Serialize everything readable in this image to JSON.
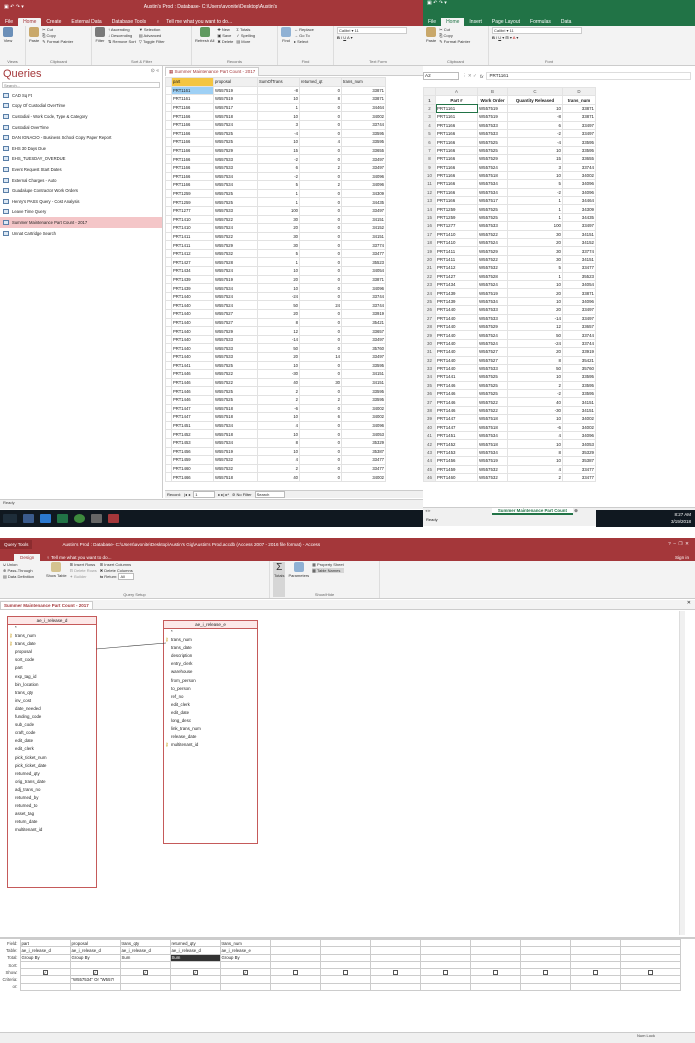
{
  "top_access": {
    "title": "Austin's Prod : Database- C:\\Users\\avonite\\Desktop\\Austin's",
    "tabs": [
      "File",
      "Home",
      "Create",
      "External Data",
      "Database Tools"
    ],
    "tell_me": "Tell me what you want to do...",
    "ribbon": {
      "view": "View",
      "paste": "Paste",
      "cut": "Cut",
      "copy": "Copy",
      "format_painter": "Format Painter",
      "filter": "Filter",
      "ascending": "Ascending",
      "descending": "Descending",
      "remove_sort": "Remove Sort",
      "selection": "Selection",
      "advanced": "Advanced",
      "toggle_filter": "Toggle Filter",
      "refresh": "Refresh All",
      "new": "New",
      "save": "Save",
      "delete": "Delete",
      "totals": "Totals",
      "spelling": "Spelling",
      "more": "More",
      "find": "Find",
      "replace": "Replace",
      "goto": "Go To",
      "select": "Select",
      "font": "Calibri",
      "size": "11",
      "groups": [
        "Views",
        "Clipboard",
        "Sort & Filter",
        "Records",
        "Find",
        "Text Form"
      ]
    },
    "nav": {
      "header": "Queries",
      "search": "Search...",
      "items": [
        "CAD Sq Ft",
        "Copy Of Custodial OverTime",
        "Custodial - Work Code, Type & Category",
        "Custodial OverTime",
        "DAN IGNACIO - Business School Copy Paper Report",
        "EHS 30 Days Due",
        "EHS_TUESDAY_OVERDUE",
        "Event Request Start Dates",
        "External Charges - Auto",
        "Guadalupe Contractor Work Orders",
        "Henry's PASS Query - Cost Analysis",
        "Leave Time Query",
        "Summer Maintenance Part Count - 2017",
        "Unnat Cartridge Search"
      ],
      "selected_index": 12
    },
    "doc_tab": "Summer Maintenance Part Count - 2017",
    "columns": [
      "part",
      "proposal",
      "SumOfTrans",
      "returned_qt",
      "trans_num"
    ],
    "rows": [
      [
        "PRT1161",
        "W557519",
        "-8",
        "0",
        "33871"
      ],
      [
        "PRT1161",
        "W557519",
        "10",
        "8",
        "33871"
      ],
      [
        "PRT1166",
        "W557517",
        "1",
        "0",
        "34464"
      ],
      [
        "PRT1166",
        "W557518",
        "10",
        "0",
        "34002"
      ],
      [
        "PRT1166",
        "W557524",
        "3",
        "0",
        "33744"
      ],
      [
        "PRT1166",
        "W557525",
        "-4",
        "0",
        "33595"
      ],
      [
        "PRT1166",
        "W557525",
        "10",
        "4",
        "33595"
      ],
      [
        "PRT1166",
        "W557529",
        "15",
        "0",
        "33655"
      ],
      [
        "PRT1166",
        "W557533",
        "-2",
        "0",
        "33497"
      ],
      [
        "PRT1166",
        "W557533",
        "6",
        "2",
        "33497"
      ],
      [
        "PRT1166",
        "W557534",
        "-2",
        "0",
        "34096"
      ],
      [
        "PRT1166",
        "W557534",
        "5",
        "2",
        "34096"
      ],
      [
        "PRT1259",
        "W557525",
        "1",
        "0",
        "34309"
      ],
      [
        "PRT1259",
        "W557525",
        "1",
        "0",
        "34435"
      ],
      [
        "PRT1277",
        "W557533",
        "100",
        "0",
        "33497"
      ],
      [
        "PRT1410",
        "W557522",
        "30",
        "0",
        "34151"
      ],
      [
        "PRT1410",
        "W557524",
        "20",
        "0",
        "34152"
      ],
      [
        "PRT1411",
        "W557522",
        "30",
        "0",
        "34151"
      ],
      [
        "PRT1411",
        "W557529",
        "30",
        "0",
        "33774"
      ],
      [
        "PRT1412",
        "W557532",
        "5",
        "0",
        "33477"
      ],
      [
        "PRT1427",
        "W557528",
        "1",
        "0",
        "35523"
      ],
      [
        "PRT1434",
        "W557524",
        "10",
        "0",
        "34054"
      ],
      [
        "PRT1439",
        "W557519",
        "20",
        "0",
        "33871"
      ],
      [
        "PRT1439",
        "W557534",
        "10",
        "0",
        "34096"
      ],
      [
        "PRT1440",
        "W557524",
        "-24",
        "0",
        "33744"
      ],
      [
        "PRT1440",
        "W557524",
        "50",
        "24",
        "33744"
      ],
      [
        "PRT1440",
        "W557527",
        "20",
        "0",
        "33919"
      ],
      [
        "PRT1440",
        "W557527",
        "8",
        "0",
        "35421"
      ],
      [
        "PRT1440",
        "W557529",
        "12",
        "0",
        "33657"
      ],
      [
        "PRT1440",
        "W557533",
        "-14",
        "0",
        "33497"
      ],
      [
        "PRT1440",
        "W557533",
        "50",
        "0",
        "35760"
      ],
      [
        "PRT1440",
        "W557533",
        "20",
        "14",
        "33497"
      ],
      [
        "PRT1441",
        "W557525",
        "10",
        "0",
        "33595"
      ],
      [
        "PRT1446",
        "W557522",
        "-30",
        "0",
        "34151"
      ],
      [
        "PRT1446",
        "W557522",
        "40",
        "30",
        "34151"
      ],
      [
        "PRT1446",
        "W557525",
        "2",
        "0",
        "33595"
      ],
      [
        "PRT1446",
        "W557525",
        "2",
        "2",
        "33595"
      ],
      [
        "PRT1447",
        "W557518",
        "-6",
        "0",
        "34002"
      ],
      [
        "PRT1447",
        "W557518",
        "10",
        "6",
        "34002"
      ],
      [
        "PRT1451",
        "W557534",
        "4",
        "0",
        "34096"
      ],
      [
        "PRT1452",
        "W557518",
        "10",
        "0",
        "34053"
      ],
      [
        "PRT1453",
        "W557534",
        "8",
        "0",
        "35329"
      ],
      [
        "PRT1456",
        "W557519",
        "10",
        "0",
        "35387"
      ],
      [
        "PRT1459",
        "W557532",
        "4",
        "0",
        "33477"
      ],
      [
        "PRT1460",
        "W557532",
        "2",
        "0",
        "33477"
      ],
      [
        "PRT1466",
        "W557518",
        "40",
        "0",
        "34002"
      ]
    ],
    "record_nav": {
      "label": "Record:",
      "current": "1",
      "no_filter": "No Filter",
      "search": "Search"
    },
    "status": "Ready"
  },
  "excel": {
    "tabs": [
      "File",
      "Home",
      "Insert",
      "Page Layout",
      "Formulas",
      "Data"
    ],
    "ribbon": {
      "paste": "Paste",
      "cut": "Cut",
      "copy": "Copy",
      "format_painter": "Format Painter",
      "font": "Calibri",
      "size": "11",
      "groups": [
        "Clipboard",
        "Font"
      ]
    },
    "namebox": "A2",
    "fx": "fx",
    "formula": "PRT1161",
    "col_letters": [
      "A",
      "B",
      "C",
      "D"
    ],
    "headers": [
      "Part #",
      "Work Order",
      "Quantity Released",
      "trans_num"
    ],
    "rows": [
      [
        "PRT1161",
        "W557519",
        "10",
        "33871"
      ],
      [
        "PRT1161",
        "W557519",
        "-8",
        "33871"
      ],
      [
        "PRT1166",
        "W557533",
        "6",
        "33497"
      ],
      [
        "PRT1166",
        "W557533",
        "-2",
        "33497"
      ],
      [
        "PRT1166",
        "W557525",
        "-4",
        "33595"
      ],
      [
        "PRT1166",
        "W557525",
        "10",
        "33595"
      ],
      [
        "PRT1166",
        "W557529",
        "15",
        "33655"
      ],
      [
        "PRT1166",
        "W557524",
        "3",
        "33744"
      ],
      [
        "PRT1166",
        "W557518",
        "10",
        "34002"
      ],
      [
        "PRT1166",
        "W557534",
        "5",
        "34096"
      ],
      [
        "PRT1166",
        "W557534",
        "-2",
        "34096"
      ],
      [
        "PRT1166",
        "W557517",
        "1",
        "34464"
      ],
      [
        "PRT1259",
        "W557525",
        "1",
        "34309"
      ],
      [
        "PRT1259",
        "W557525",
        "1",
        "34435"
      ],
      [
        "PRT1277",
        "W557533",
        "100",
        "33497"
      ],
      [
        "PRT1410",
        "W557522",
        "30",
        "34151"
      ],
      [
        "PRT1410",
        "W557524",
        "20",
        "34152"
      ],
      [
        "PRT1411",
        "W557529",
        "30",
        "33774"
      ],
      [
        "PRT1411",
        "W557522",
        "30",
        "34151"
      ],
      [
        "PRT1412",
        "W557532",
        "5",
        "33477"
      ],
      [
        "PRT1427",
        "W557528",
        "1",
        "35523"
      ],
      [
        "PRT1434",
        "W557524",
        "10",
        "34054"
      ],
      [
        "PRT1439",
        "W557519",
        "20",
        "33871"
      ],
      [
        "PRT1439",
        "W557534",
        "10",
        "34096"
      ],
      [
        "PRT1440",
        "W557533",
        "20",
        "33497"
      ],
      [
        "PRT1440",
        "W557533",
        "-14",
        "33497"
      ],
      [
        "PRT1440",
        "W557529",
        "12",
        "33657"
      ],
      [
        "PRT1440",
        "W557524",
        "50",
        "33744"
      ],
      [
        "PRT1440",
        "W557524",
        "-24",
        "33744"
      ],
      [
        "PRT1440",
        "W557527",
        "20",
        "33919"
      ],
      [
        "PRT1440",
        "W557527",
        "8",
        "35421"
      ],
      [
        "PRT1440",
        "W557533",
        "50",
        "35760"
      ],
      [
        "PRT1441",
        "W557525",
        "10",
        "33595"
      ],
      [
        "PRT1446",
        "W557525",
        "2",
        "33595"
      ],
      [
        "PRT1446",
        "W557525",
        "-2",
        "33595"
      ],
      [
        "PRT1446",
        "W557522",
        "40",
        "34151"
      ],
      [
        "PRT1446",
        "W557522",
        "-30",
        "34151"
      ],
      [
        "PRT1447",
        "W557518",
        "10",
        "34002"
      ],
      [
        "PRT1447",
        "W557518",
        "-6",
        "34002"
      ],
      [
        "PRT1451",
        "W557534",
        "4",
        "34096"
      ],
      [
        "PRT1452",
        "W557518",
        "10",
        "34053"
      ],
      [
        "PRT1453",
        "W557534",
        "8",
        "35329"
      ],
      [
        "PRT1456",
        "W557519",
        "10",
        "35387"
      ],
      [
        "PRT1459",
        "W557532",
        "4",
        "33477"
      ],
      [
        "PRT1460",
        "W557532",
        "2",
        "33477"
      ]
    ],
    "sheet_tab": "Summer Maintenance Part Count",
    "status": "Ready"
  },
  "taskbar": {
    "time": "8:27 AM",
    "date": "3/19/2018"
  },
  "bottom_access": {
    "tools_label": "Query Tools",
    "title": "Austin's Prod : Database- C:\\Users\\avonite\\Desktop\\Austin's Gig\\Austin's Prod.accdb (Access 2007 - 2016 file format) - Access",
    "user": "Sign in",
    "tab": "Design",
    "tell_me": "Tell me what you want to do...",
    "ribbon": {
      "union": "Union",
      "pass_through": "Pass-Through",
      "data_def": "Data Definition",
      "show_table": "Show Table",
      "insert_rows": "Insert Rows",
      "delete_rows": "Delete Rows",
      "builder": "Builder",
      "insert_cols": "Insert Columns",
      "delete_cols": "Delete Columns",
      "return": "Return:",
      "return_val": "All",
      "totals": "Totals",
      "parameters": "Parameters",
      "property_sheet": "Property Sheet",
      "table_names": "Table Names",
      "groups": [
        "Query Setup",
        "Show/Hide"
      ]
    },
    "doc_tab": "Summer Maintenance Part Count - 2017",
    "table1": {
      "name": "ae_i_release_d",
      "fields": [
        "*",
        "trans_num",
        "trans_date",
        "proposal",
        "sort_code",
        "part",
        "exp_tag_id",
        "bin_location",
        "trans_qty",
        "inv_cost",
        "date_needed",
        "funding_code",
        "sub_code",
        "craft_code",
        "edit_date",
        "edit_clerk",
        "pick_ticket_num",
        "pick_ticket_date",
        "returned_qty",
        "orig_trans_date",
        "adj_trans_no",
        "returned_by",
        "returned_to",
        "asset_tag",
        "return_date",
        "multitenant_id"
      ],
      "keys": [
        1,
        2
      ]
    },
    "table2": {
      "name": "ae_i_release_e",
      "fields": [
        "*",
        "trans_num",
        "trans_date",
        "description",
        "entry_clerk",
        "warehouse",
        "from_person",
        "to_person",
        "ref_no",
        "edit_clerk",
        "edit_date",
        "long_desc",
        "link_trans_num",
        "release_date",
        "multitenant_id"
      ],
      "keys": [
        1,
        14
      ]
    },
    "grid": {
      "row_labels": [
        "Field:",
        "Table:",
        "Total:",
        "Sort:",
        "Show:",
        "Criteria:",
        "or:"
      ],
      "columns": [
        {
          "field": "part",
          "table": "ae_i_release_d",
          "total": "Group By",
          "criteria": ""
        },
        {
          "field": "proposal",
          "table": "ae_i_release_d",
          "total": "Group By",
          "criteria": "\"W557534\" Or \"W557!"
        },
        {
          "field": "trans_qty",
          "table": "ae_i_release_d",
          "total": "Sum",
          "criteria": ""
        },
        {
          "field": "returned_qty",
          "table": "ae_i_release_d",
          "total": "Sum",
          "criteria": ""
        },
        {
          "field": "trans_num",
          "table": "ae_i_release_e",
          "total": "Group By",
          "criteria": ""
        }
      ]
    },
    "status": "Num Lock"
  }
}
